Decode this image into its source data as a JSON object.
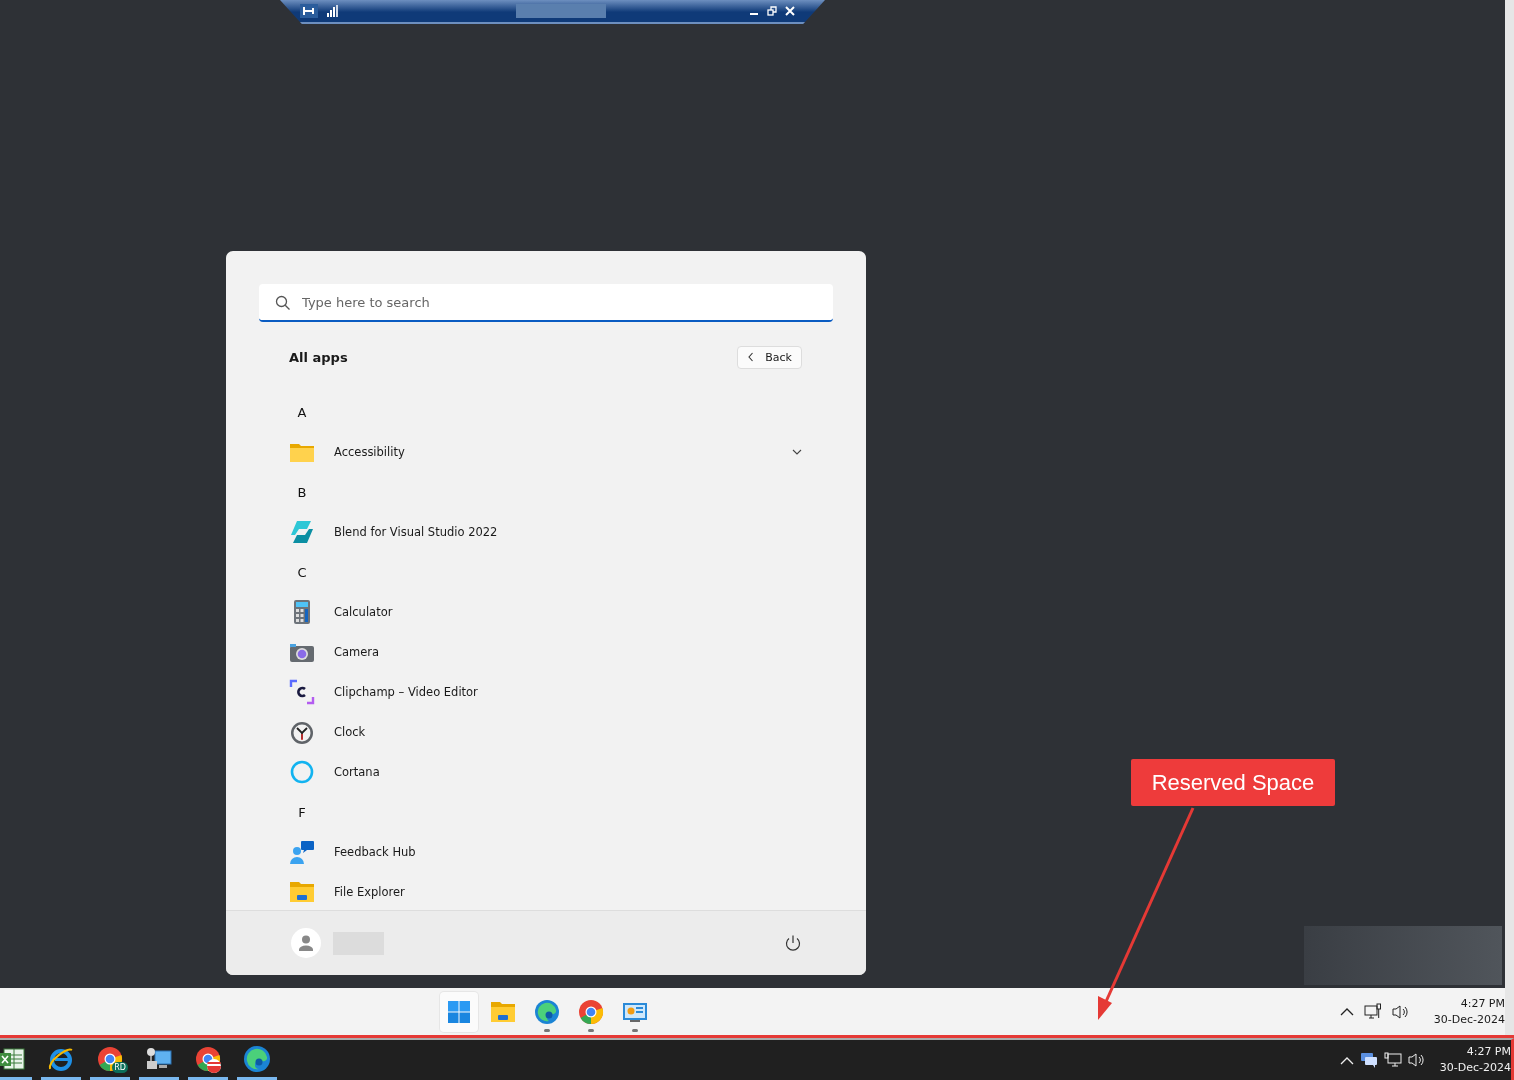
{
  "start_menu": {
    "search": {
      "placeholder": "Type here to search"
    },
    "title": "All apps",
    "back_button": "Back",
    "groups": [
      {
        "letter": "A",
        "apps": [
          {
            "name": "Accessibility",
            "kind": "folder",
            "expanded": false
          }
        ]
      },
      {
        "letter": "B",
        "apps": [
          {
            "name": "Blend for Visual Studio 2022",
            "kind": "app"
          }
        ]
      },
      {
        "letter": "C",
        "apps": [
          {
            "name": "Calculator",
            "kind": "app"
          },
          {
            "name": "Camera",
            "kind": "app"
          },
          {
            "name": "Clipchamp – Video Editor",
            "kind": "app"
          },
          {
            "name": "Clock",
            "kind": "app"
          },
          {
            "name": "Cortana",
            "kind": "app"
          }
        ]
      },
      {
        "letter": "F",
        "apps": [
          {
            "name": "Feedback Hub",
            "kind": "app"
          },
          {
            "name": "File Explorer",
            "kind": "app"
          }
        ]
      }
    ]
  },
  "remote_taskbar": {
    "apps": [
      {
        "selected": true,
        "running": false
      },
      {
        "selected": false,
        "running": false
      },
      {
        "selected": false,
        "running": true
      },
      {
        "selected": false,
        "running": true
      },
      {
        "selected": false,
        "running": true
      }
    ],
    "time": "4:27 PM",
    "date": "30-Dec-2024"
  },
  "callout": {
    "text": "Reserved Space"
  },
  "host_taskbar": {
    "apps": [
      {
        "active": true
      },
      {
        "active": true
      },
      {
        "active": true,
        "badge": "RD"
      },
      {
        "active": true
      },
      {
        "active": true
      },
      {
        "active": true
      }
    ],
    "time": "4:27 PM",
    "date": "30-Dec-2024"
  }
}
